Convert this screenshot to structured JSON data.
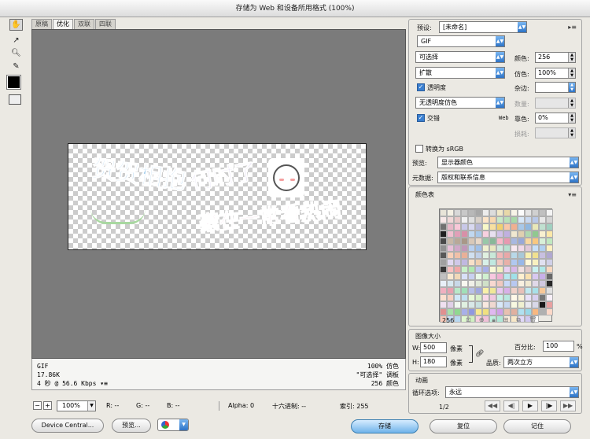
{
  "window": {
    "title": "存储为 Web 和设备所用格式 (100%)"
  },
  "tabs": [
    "原稿",
    "优化",
    "双联",
    "四联"
  ],
  "artwork": {
    "text_lines": [
      "贺贺相抱",
      "何时了",
      "豪在一常看热闹"
    ]
  },
  "info": {
    "format": "GIF",
    "size": "17.86K",
    "time": "4 秒 @ 56.6 Kbps",
    "dither": "100% 仿色",
    "palette_type": "\"可选择\" 调板",
    "colors": "256 颜色"
  },
  "status": {
    "zoom": "100%",
    "r": "R: --",
    "g": "G: --",
    "b": "B: --",
    "alpha": "Alpha: 0",
    "hex": "十六进制: --",
    "index": "索引: 255"
  },
  "buttons": {
    "device_central": "Device Central...",
    "preview": "预览...",
    "save": "存储",
    "reset": "复位",
    "done": "记住"
  },
  "settings": {
    "preset_label": "预设:",
    "preset_value": "[未命名]",
    "format": "GIF",
    "reduction": "可选择",
    "colors_label": "颜色:",
    "colors_value": "256",
    "dither_algo": "扩散",
    "dither_label": "仿色:",
    "dither_value": "100%",
    "transparency_label": "透明度",
    "transparency_checked": true,
    "matte_label": "杂边:",
    "matte_value": "",
    "trans_dither": "无透明度仿色",
    "amount_label": "数量:",
    "interlaced_label": "交错",
    "interlaced_checked": true,
    "websnap_prefix": "Web",
    "websnap_label": "靠色:",
    "websnap_value": "0%",
    "lossy_label": "损耗:",
    "srgb_label": "转换为 sRGB",
    "srgb_checked": false,
    "preview_label": "预览:",
    "preview_value": "显示器颜色",
    "metadata_label": "元数据:",
    "metadata_value": "版权和联系信息"
  },
  "color_table": {
    "title": "颜色表",
    "count": "256",
    "colors": [
      "#e8e4d8",
      "#f4f0e4",
      "#d8d8d8",
      "#c8c8c8",
      "#b8b8b8",
      "#a8a8a8",
      "#ececec",
      "#dcdcdc",
      "#f0e8c8",
      "#e8d8a8",
      "#f8f4e8",
      "#fcfcfc",
      "#e4e4e4",
      "#d0d0d0",
      "#c0c0c0",
      "#f4f4f4",
      "#f8e8e8",
      "#f0d8d8",
      "#e8c8c8",
      "#f0f0f0",
      "#e0e0e0",
      "#d8d0c8",
      "#fce4c8",
      "#f8d8b0",
      "#c8e8c8",
      "#b8e0b8",
      "#a8d8a8",
      "#d8e8f8",
      "#c8d8f0",
      "#b8c8e8",
      "#e8e8e8",
      "#d4d4d4",
      "#707070",
      "#e8b8c8",
      "#f8c8d8",
      "#c8c8e8",
      "#d8d8f0",
      "#b8b8d8",
      "#f8f8c8",
      "#f8e0a0",
      "#f0d070",
      "#f8c8a8",
      "#f0b090",
      "#a8c8e8",
      "#90b8e0",
      "#e8e8b8",
      "#c0e0d0",
      "#a0d0c0",
      "#202020",
      "#f0c0d0",
      "#e0a0b8",
      "#d890a8",
      "#c0d8f0",
      "#a8c8e8",
      "#f8d0e0",
      "#e8e0f0",
      "#d0c0e8",
      "#c0b0e0",
      "#f0e8d0",
      "#e0d0b0",
      "#b0d8b0",
      "#90c890",
      "#f8f0d0",
      "#fce8a8",
      "#484848",
      "#c8b8a8",
      "#b8a898",
      "#a89888",
      "#d8c8b8",
      "#e8d8c8",
      "#98c8a8",
      "#88b898",
      "#f8b8c8",
      "#e898b0",
      "#a8b8e0",
      "#98a8d8",
      "#f8d8a0",
      "#f8c880",
      "#d8f0d8",
      "#c0e8c0",
      "#909090",
      "#e8c0d8",
      "#d0a8c8",
      "#c098b8",
      "#b8d0f0",
      "#a0c0e8",
      "#f0f0d0",
      "#e8e8c0",
      "#d0e8e0",
      "#b8e0d0",
      "#f8e8f0",
      "#f0d8e8",
      "#e0c8d8",
      "#c8e0f8",
      "#b0d0f0",
      "#fff0c0",
      "#585858",
      "#f8d0b8",
      "#f0c0a8",
      "#e8b098",
      "#d0e0f0",
      "#c0d0e8",
      "#e0f0e0",
      "#c8e8d8",
      "#f0b8b8",
      "#e8a8a8",
      "#b8d8e8",
      "#a8c8d8",
      "#f8f0b0",
      "#f0e090",
      "#c8c0e0",
      "#b0a8d0",
      "#a0a0a0",
      "#e0d8f0",
      "#d0c8e8",
      "#c0b8e0",
      "#f8e0c8",
      "#f0d0b0",
      "#d8f0e8",
      "#c0e8e0",
      "#f0c8c0",
      "#e8b0a8",
      "#b0c8f0",
      "#98b8e8",
      "#fff8d8",
      "#f8f0c0",
      "#e0e0f0",
      "#d0d0e8",
      "#383838",
      "#f8c0c0",
      "#f0a8a8",
      "#c8f0c8",
      "#b0e8b0",
      "#c0c8f0",
      "#a8b0e8",
      "#f8f8d8",
      "#f0f0c0",
      "#e8d0f0",
      "#d8b8e8",
      "#f0e0e0",
      "#e0c8c8",
      "#c8f0f0",
      "#b0e8e8",
      "#f8d8c0",
      "#c0c0c0",
      "#f8e8d0",
      "#f0d8b8",
      "#d8e0f8",
      "#c8d0f0",
      "#e8f8e8",
      "#d0f0d0",
      "#f8c8e0",
      "#f0b0d0",
      "#b8e8f0",
      "#a0e0e8",
      "#fff0d0",
      "#f8e0b0",
      "#d8c8f0",
      "#c8b0e8",
      "#686868",
      "#e8f0f8",
      "#d8e8f0",
      "#c8d8e8",
      "#f8f8f0",
      "#f0f0e8",
      "#e0e8d8",
      "#d0e0c8",
      "#f8d8d0",
      "#f0c8c0",
      "#c8d8f8",
      "#b8c8f0",
      "#f8f0e0",
      "#f0e8d0",
      "#e0d8e8",
      "#d0c8e0",
      "#282828",
      "#f0b0c0",
      "#e8a0b0",
      "#b8e8c8",
      "#a0e0b8",
      "#b8c0e8",
      "#a0a8e0",
      "#f8f0a8",
      "#f0e898",
      "#e8c8f0",
      "#d8b0e8",
      "#f0d0c8",
      "#e8c0b8",
      "#c0e8f0",
      "#a8e0e8",
      "#f8c898",
      "#e0e0e0",
      "#fce0d0",
      "#f8d0c0",
      "#d0e8f8",
      "#c0e0f0",
      "#e8f8d8",
      "#d8f0c8",
      "#f8d8e8",
      "#f0c8e0",
      "#c8f0e8",
      "#b8e8e0",
      "#fff8e8",
      "#f8f0d8",
      "#e8e0f8",
      "#d8d0f0",
      "#787878",
      "#f8f0f8",
      "#f0e0f0",
      "#e0d0e8",
      "#f0f8f0",
      "#e0f0e0",
      "#d8e8e8",
      "#c8e0e0",
      "#f8e8e0",
      "#f0d8d0",
      "#d8e8f8",
      "#c8d8f0",
      "#f8f8e0",
      "#f0f0d0",
      "#e8e8f0",
      "#d8d8e8",
      "#181818",
      "#e8a0a0",
      "#e09090",
      "#a8e0a8",
      "#90d890",
      "#a8b0e8",
      "#9098e0",
      "#f8e890",
      "#f0e080",
      "#e0b8f0",
      "#d0a0e8",
      "#e8c0b0",
      "#e0b0a0",
      "#b0e0f0",
      "#98d8e8",
      "#f8b880",
      "#b0b0b0",
      "#fcd8c8",
      "#f8c8b8",
      "#c8e0f8",
      "#b8d8f0",
      "#e0f8d0",
      "#d0f0c0",
      "#f8d0e0",
      "#f0c0d8",
      "#c0f0e0",
      "#b0e8d8",
      "#fff0e0",
      "#f8e8c8",
      "#e0d8f8",
      "#d0c8f0",
      "#ffffff"
    ]
  },
  "image_size": {
    "title": "图像大小",
    "w_label": "W:",
    "w_value": "500",
    "h_label": "H:",
    "h_value": "180",
    "unit": "像素",
    "percent_label": "百分比:",
    "percent_value": "100",
    "percent_unit": "%",
    "quality_label": "品质:",
    "quality_value": "两次立方"
  },
  "animation": {
    "title": "动画",
    "loop_label": "循环选项:",
    "loop_value": "永远",
    "frame": "1/2"
  }
}
